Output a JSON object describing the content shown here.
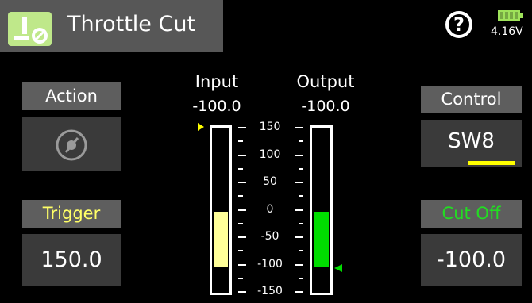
{
  "header": {
    "title": "Throttle Cut",
    "icon": "throttle-cut-icon",
    "help_icon": "help-icon"
  },
  "battery": {
    "voltage": "4.16V",
    "level": 1.0,
    "color": "#9ee25a"
  },
  "action": {
    "label": "Action",
    "icon": "action-disabled-icon"
  },
  "trigger": {
    "label": "Trigger",
    "value": "150.0",
    "label_color": "#ffff66"
  },
  "control": {
    "label": "Control",
    "value": "SW8",
    "indicator_color": "#ffff00"
  },
  "cutoff": {
    "label": "Cut Off",
    "value": "-100.0",
    "label_color": "#22dd22"
  },
  "input": {
    "title": "Input",
    "value": "-100.0",
    "value_number": -100,
    "fill_color": "#ffff99"
  },
  "output": {
    "title": "Output",
    "value": "-100.0",
    "value_number": -100,
    "fill_color": "#00dd00"
  },
  "scale": {
    "labels": [
      "150",
      "100",
      "50",
      "0",
      "-50",
      "-100",
      "-150"
    ]
  }
}
